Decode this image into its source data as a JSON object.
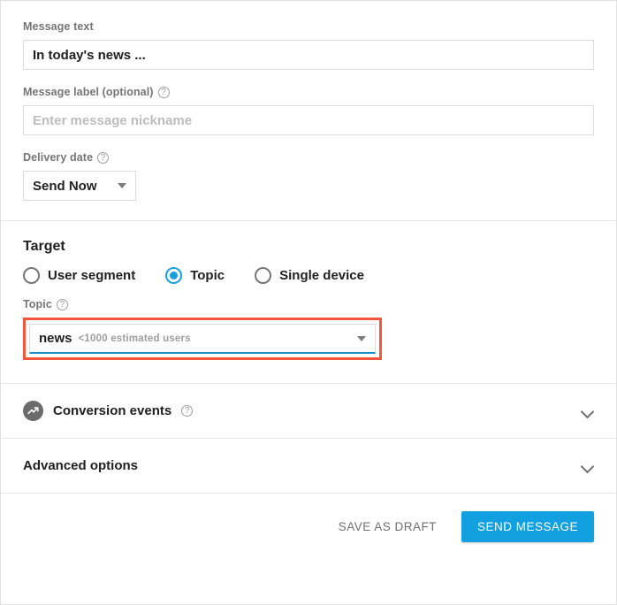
{
  "form": {
    "message_text": {
      "label": "Message text",
      "value": "In today's news ...",
      "has_help": false
    },
    "message_label": {
      "label": "Message label (optional)",
      "value": "",
      "placeholder": "Enter message nickname",
      "help_icon": "help-circle-icon"
    },
    "delivery_date": {
      "label": "Delivery date",
      "selected": "Send Now",
      "help_icon": "help-circle-icon",
      "caret_icon": "caret-down-icon"
    }
  },
  "target": {
    "title": "Target",
    "options": [
      {
        "label": "User segment",
        "selected": false
      },
      {
        "label": "Topic",
        "selected": true
      },
      {
        "label": "Single device",
        "selected": false
      }
    ],
    "topic_field": {
      "label": "Topic",
      "help_icon": "help-circle-icon",
      "value": "news",
      "hint": "<1000 estimated users",
      "caret_icon": "caret-down-icon",
      "highlight_color": "#f4563a",
      "focus_underline_color": "#1a8fd0"
    }
  },
  "collapsibles": [
    {
      "title": "Conversion events",
      "icon": "trending-up-circle-icon",
      "help_icon": "help-circle-icon",
      "chevron": "chevron-down-icon"
    },
    {
      "title": "Advanced options",
      "icon": null,
      "help_icon": null,
      "chevron": "chevron-down-icon"
    }
  ],
  "footer": {
    "save_draft_label": "SAVE AS DRAFT",
    "send_label": "SEND MESSAGE",
    "accent_color": "#12a0e0"
  },
  "icons": {
    "help": "?"
  }
}
